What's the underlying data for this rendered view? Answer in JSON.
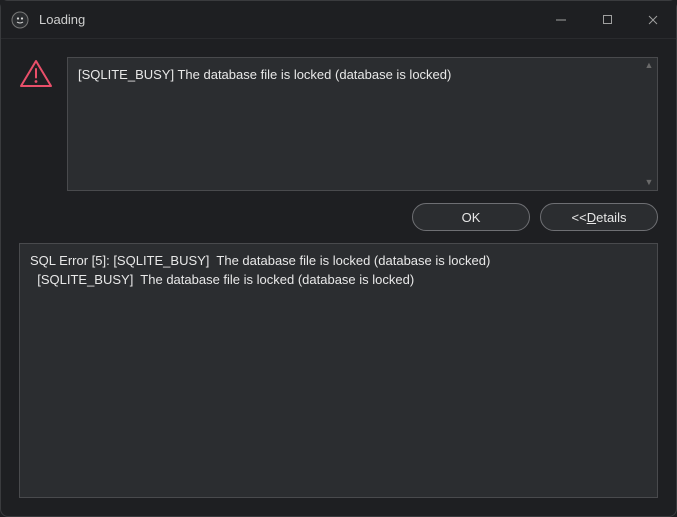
{
  "window": {
    "title": "Loading"
  },
  "message": {
    "text": "[SQLITE_BUSY]  The database file is locked (database is locked)"
  },
  "buttons": {
    "ok": "OK",
    "details_prefix": "<<  ",
    "details_u": "D",
    "details_rest": "etails"
  },
  "details": {
    "line1": "SQL Error [5]: [SQLITE_BUSY]  The database file is locked (database is locked)",
    "line2": "  [SQLITE_BUSY]  The database file is locked (database is locked)"
  }
}
